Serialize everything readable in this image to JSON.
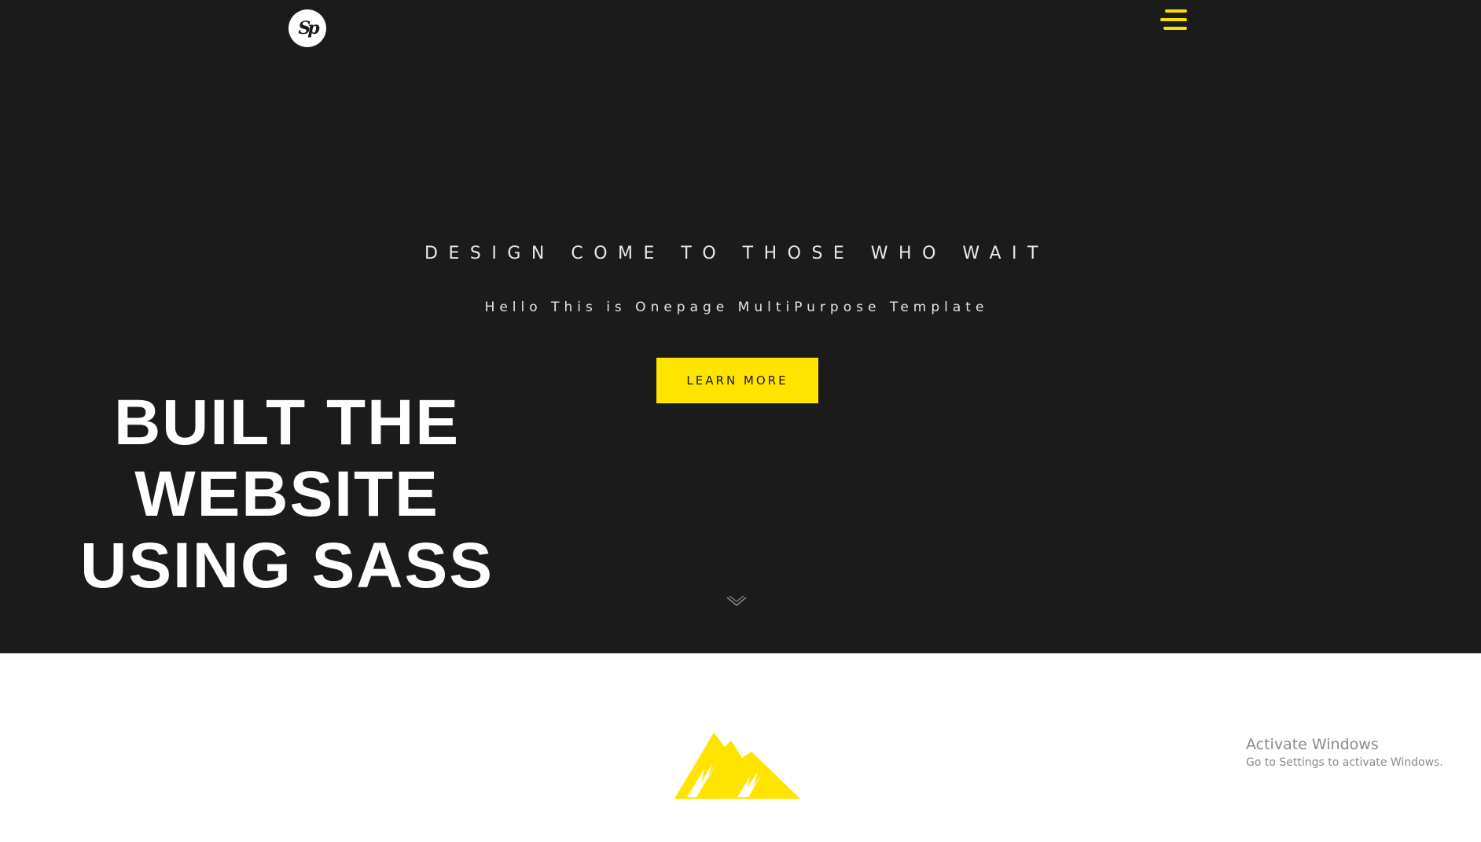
{
  "header": {
    "logo_text": "Sp",
    "menu_icon": "hamburger-menu-icon",
    "accent_color": "#f7e000"
  },
  "hero": {
    "tagline": "DESIGN COME TO THOSE WHO WAIT",
    "subtitle": "Hello This is Onepage MultiPurpose Template",
    "cta_label": "LEARN MORE",
    "big_title_lines": [
      "BUILT THE",
      "WEBSITE",
      "USING SASS"
    ],
    "scroll_icon": "chevron-down-icon",
    "background_color": "#1b1b1b",
    "button_color": "#ffe400"
  },
  "section": {
    "icon": "mountain-icon"
  },
  "os_overlay": {
    "title": "Activate Windows",
    "subtitle": "Go to Settings to activate Windows."
  }
}
